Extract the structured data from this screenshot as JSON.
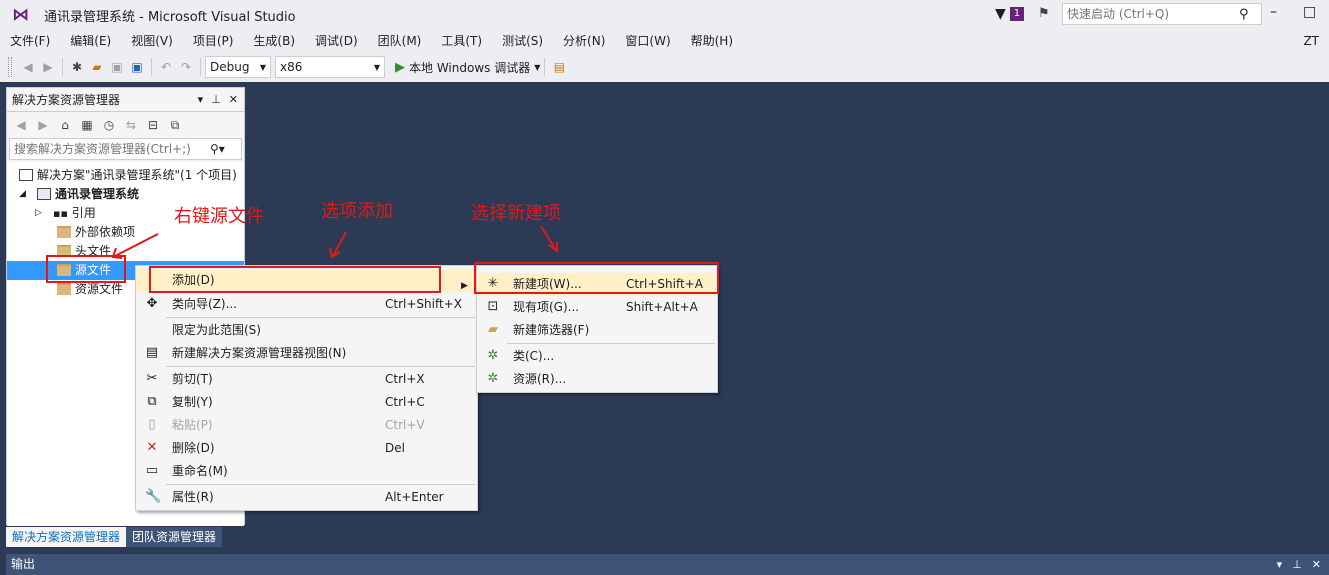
{
  "window": {
    "title": "通讯录管理系统 - Microsoft Visual Studio",
    "notify_count": "1",
    "quick_launch_placeholder": "快速启动 (Ctrl+Q)",
    "user": "ZT"
  },
  "menu": [
    "文件(F)",
    "编辑(E)",
    "视图(V)",
    "项目(P)",
    "生成(B)",
    "调试(D)",
    "团队(M)",
    "工具(T)",
    "测试(S)",
    "分析(N)",
    "窗口(W)",
    "帮助(H)"
  ],
  "toolbar": {
    "config": "Debug",
    "platform": "x86",
    "run_label": "本地 Windows 调试器"
  },
  "solution_explorer": {
    "title": "解决方案资源管理器",
    "search_placeholder": "搜索解决方案资源管理器(Ctrl+;)",
    "nodes": [
      {
        "label": "解决方案\"通讯录管理系统\"(1 个项目)"
      },
      {
        "label": "通讯录管理系统"
      },
      {
        "label": "引用"
      },
      {
        "label": "外部依赖项"
      },
      {
        "label": "头文件"
      },
      {
        "label": "源文件"
      },
      {
        "label": "资源文件"
      }
    ],
    "tabs": [
      "解决方案资源管理器",
      "团队资源管理器"
    ]
  },
  "output_panel": {
    "title": "输出"
  },
  "context_menu": [
    {
      "label": "添加(D)",
      "shortcut": ""
    },
    {
      "label": "类向导(Z)...",
      "shortcut": "Ctrl+Shift+X"
    },
    {
      "label": "限定为此范围(S)",
      "shortcut": ""
    },
    {
      "label": "新建解决方案资源管理器视图(N)",
      "shortcut": ""
    },
    {
      "label": "剪切(T)",
      "shortcut": "Ctrl+X"
    },
    {
      "label": "复制(Y)",
      "shortcut": "Ctrl+C"
    },
    {
      "label": "粘贴(P)",
      "shortcut": "Ctrl+V"
    },
    {
      "label": "删除(D)",
      "shortcut": "Del"
    },
    {
      "label": "重命名(M)",
      "shortcut": ""
    },
    {
      "label": "属性(R)",
      "shortcut": "Alt+Enter"
    }
  ],
  "submenu": [
    {
      "label": "新建项(W)...",
      "shortcut": "Ctrl+Shift+A"
    },
    {
      "label": "现有项(G)...",
      "shortcut": "Shift+Alt+A"
    },
    {
      "label": "新建筛选器(F)",
      "shortcut": ""
    },
    {
      "label": "类(C)...",
      "shortcut": ""
    },
    {
      "label": "资源(R)...",
      "shortcut": ""
    }
  ],
  "annotations": {
    "right_click": "右键源文件",
    "choose_add": "选项添加",
    "choose_new": "选择新建项",
    "color": "#e01919"
  }
}
